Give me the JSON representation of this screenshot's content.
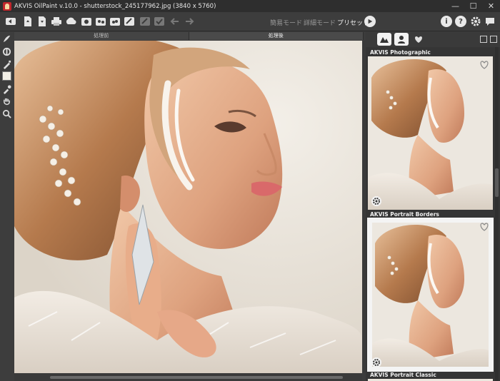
{
  "window": {
    "title": "AKVIS OilPaint v.10.0 - shutterstock_245177962.jpg (3840 x 5760)",
    "controls": [
      "—",
      "☐",
      "✕"
    ]
  },
  "toolbar": {
    "icons": [
      "open-icon",
      "save-icon",
      "import-icon",
      "print-icon",
      "publish-icon",
      "batch-icon",
      "plugin-icon",
      "preferences-icon",
      "share-icon",
      "run-icon",
      "apply-icon",
      "undo-icon",
      "redo-icon"
    ],
    "modes": {
      "simple": "簡易モード",
      "advanced": "詳細モード",
      "presets": "プリセット"
    }
  },
  "tools": [
    "brush-stroke-icon",
    "smart-brush-icon",
    "history-brush-icon",
    "color-swatch",
    "eyedropper-icon",
    "hand-icon",
    "zoom-icon"
  ],
  "tabs": {
    "before": "処理前",
    "after": "処理後"
  },
  "panel": {
    "tabs": [
      "landscape-presets-tab",
      "portrait-presets-tab",
      "favorites-tab"
    ],
    "presets": [
      {
        "name": "AKVIS Photographic",
        "favorite": false
      },
      {
        "name": "AKVIS Portrait Borders",
        "favorite": false,
        "selected": true
      },
      {
        "name": "AKVIS Portrait Classic",
        "favorite": false
      }
    ]
  },
  "colors": {
    "accent": "#f2f2f2",
    "background": "#3c3c3c",
    "titlebar": "#2e2e2e"
  }
}
